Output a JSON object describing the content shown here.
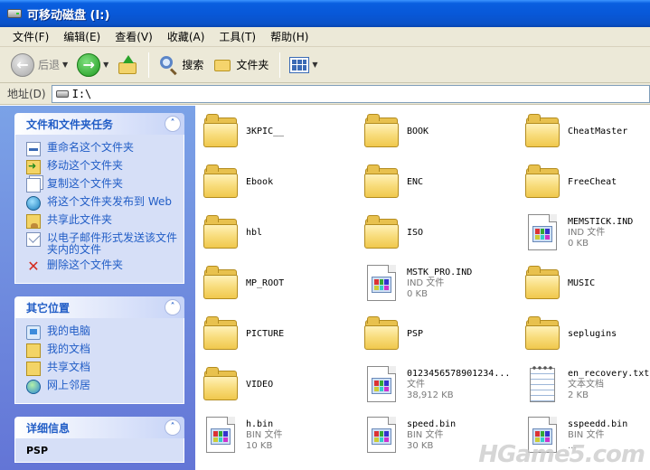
{
  "window": {
    "title": "可移动磁盘 (I:)"
  },
  "menu": [
    "文件(F)",
    "编辑(E)",
    "查看(V)",
    "收藏(A)",
    "工具(T)",
    "帮助(H)"
  ],
  "toolbar": {
    "back_label": "后退",
    "search_label": "搜索",
    "folders_label": "文件夹"
  },
  "address": {
    "label": "地址(D)",
    "value": "I:\\"
  },
  "tasks_panel": {
    "title": "文件和文件夹任务",
    "items": [
      {
        "label": "重命名这个文件夹",
        "icon": "rename-icon"
      },
      {
        "label": "移动这个文件夹",
        "icon": "move-icon"
      },
      {
        "label": "复制这个文件夹",
        "icon": "copy-icon"
      },
      {
        "label": "将这个文件夹发布到 Web",
        "icon": "web-publish-icon"
      },
      {
        "label": "共享此文件夹",
        "icon": "share-icon"
      },
      {
        "label": "以电子邮件形式发送该文件夹内的文件",
        "icon": "email-icon"
      },
      {
        "label": "删除这个文件夹",
        "icon": "delete-icon"
      }
    ]
  },
  "places_panel": {
    "title": "其它位置",
    "items": [
      {
        "label": "我的电脑",
        "icon": "my-computer-icon"
      },
      {
        "label": "我的文档",
        "icon": "my-documents-icon"
      },
      {
        "label": "共享文档",
        "icon": "shared-documents-icon"
      },
      {
        "label": "网上邻居",
        "icon": "network-places-icon"
      }
    ]
  },
  "details_panel": {
    "title": "详细信息",
    "name": "PSP"
  },
  "files": [
    {
      "name": "3KPIC__",
      "kind": "folder"
    },
    {
      "name": "BOOK",
      "kind": "folder"
    },
    {
      "name": "CheatMaster",
      "kind": "folder"
    },
    {
      "name": "Ebook",
      "kind": "folder"
    },
    {
      "name": "ENC",
      "kind": "folder"
    },
    {
      "name": "FreeCheat",
      "kind": "folder"
    },
    {
      "name": "hbl",
      "kind": "folder"
    },
    {
      "name": "ISO",
      "kind": "folder"
    },
    {
      "name": "MEMSTICK.IND",
      "kind": "doc",
      "type": "IND 文件",
      "size": "0 KB"
    },
    {
      "name": "MP_ROOT",
      "kind": "folder"
    },
    {
      "name": "MSTK_PRO.IND",
      "kind": "doc",
      "type": "IND 文件",
      "size": "0 KB"
    },
    {
      "name": "MUSIC",
      "kind": "folder"
    },
    {
      "name": "PICTURE",
      "kind": "folder"
    },
    {
      "name": "PSP",
      "kind": "folder"
    },
    {
      "name": "seplugins",
      "kind": "folder"
    },
    {
      "name": "VIDEO",
      "kind": "folder"
    },
    {
      "name": "0123456578901234...",
      "kind": "doc",
      "type": "文件",
      "size": "38,912 KB"
    },
    {
      "name": "en_recovery.txt",
      "kind": "note",
      "type": "文本文档",
      "size": "2 KB"
    },
    {
      "name": "h.bin",
      "kind": "doc",
      "type": "BIN 文件",
      "size": "10 KB"
    },
    {
      "name": "speed.bin",
      "kind": "doc",
      "type": "BIN 文件",
      "size": "30 KB"
    },
    {
      "name": "sspeedd.bin",
      "kind": "doc",
      "type": "BIN 文件",
      "size": "..."
    }
  ],
  "watermark": "HGame5.com"
}
